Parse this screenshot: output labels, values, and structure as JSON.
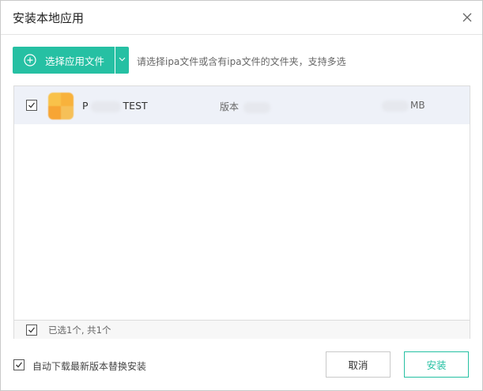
{
  "dialog": {
    "title": "安装本地应用",
    "close_icon": "close-icon"
  },
  "toolbar": {
    "select_files_label": "选择应用文件",
    "plus_icon": "plus-circle-icon",
    "dropdown_icon": "chevron-down-icon",
    "hint": "请选择ipa文件或含有ipa文件的文件夹，支持多选"
  },
  "list": {
    "items": [
      {
        "checked": true,
        "name_prefix": "P",
        "name_suffix": "TEST",
        "version_label": "版本",
        "size_unit": "MB"
      }
    ],
    "footer": {
      "checked": true,
      "selection_text": "已选1个, 共1个"
    }
  },
  "footer": {
    "auto_download_checked": true,
    "auto_download_label": "自动下载最新版本替换安装",
    "cancel_label": "取消",
    "install_label": "安装"
  },
  "colors": {
    "accent": "#26c0a3",
    "row_highlight": "#eef1f8"
  }
}
